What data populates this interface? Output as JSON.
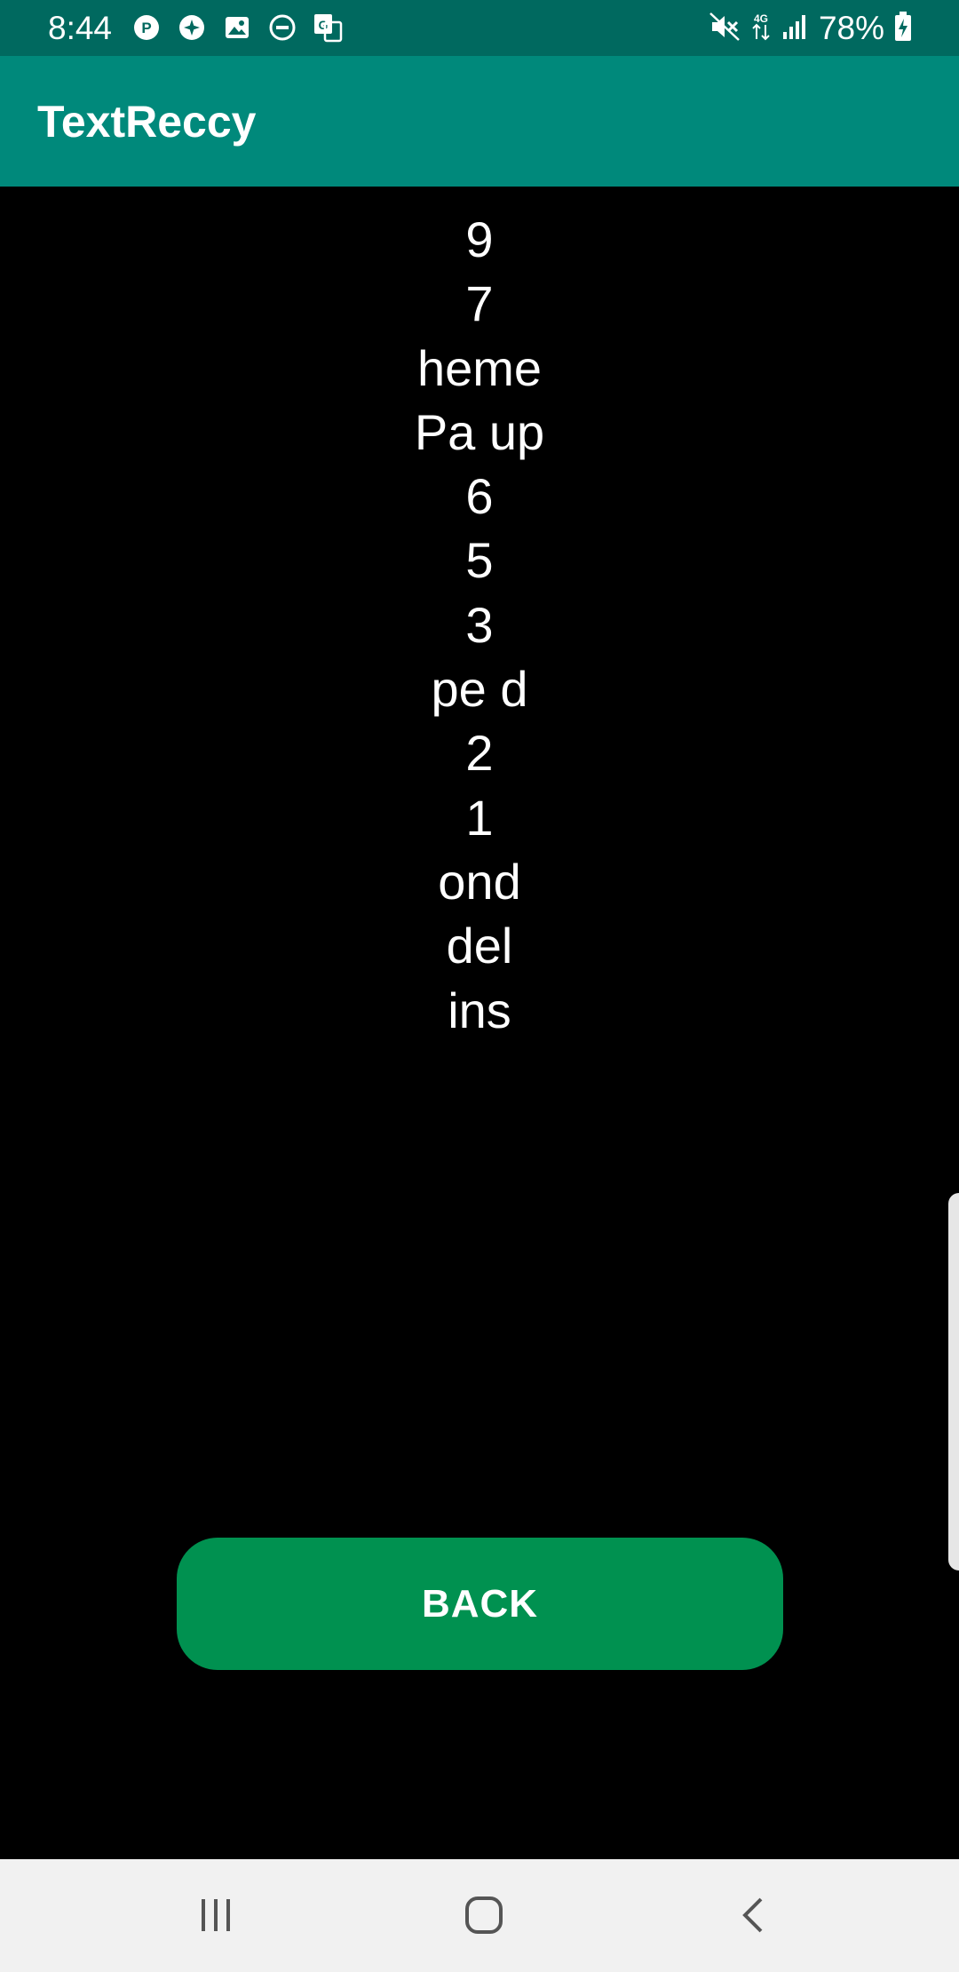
{
  "status_bar": {
    "time": "8:44",
    "left_icons": [
      "p-icon",
      "pinwheel-icon",
      "gallery-icon",
      "do-not-disturb-icon",
      "translate-icon"
    ],
    "right_icons": [
      "mute-icon",
      "4g-data-icon",
      "signal-icon",
      "battery-charging-icon"
    ],
    "battery": "78%"
  },
  "app_bar": {
    "title": "TextReccy"
  },
  "content": {
    "lines": [
      "9",
      "7",
      "heme",
      "Pa up",
      "6",
      "5",
      "3",
      "pe d",
      "2",
      "1",
      "ond",
      "del",
      "ins"
    ]
  },
  "actions": {
    "back_label": "BACK"
  },
  "nav_bar": {
    "icons": [
      "recents-icon",
      "home-icon",
      "back-icon"
    ]
  },
  "colors": {
    "status_bar": "#00695f",
    "app_bar": "#00897b",
    "background": "#000000",
    "button": "#009150",
    "nav_bar": "#f1f1f1"
  }
}
